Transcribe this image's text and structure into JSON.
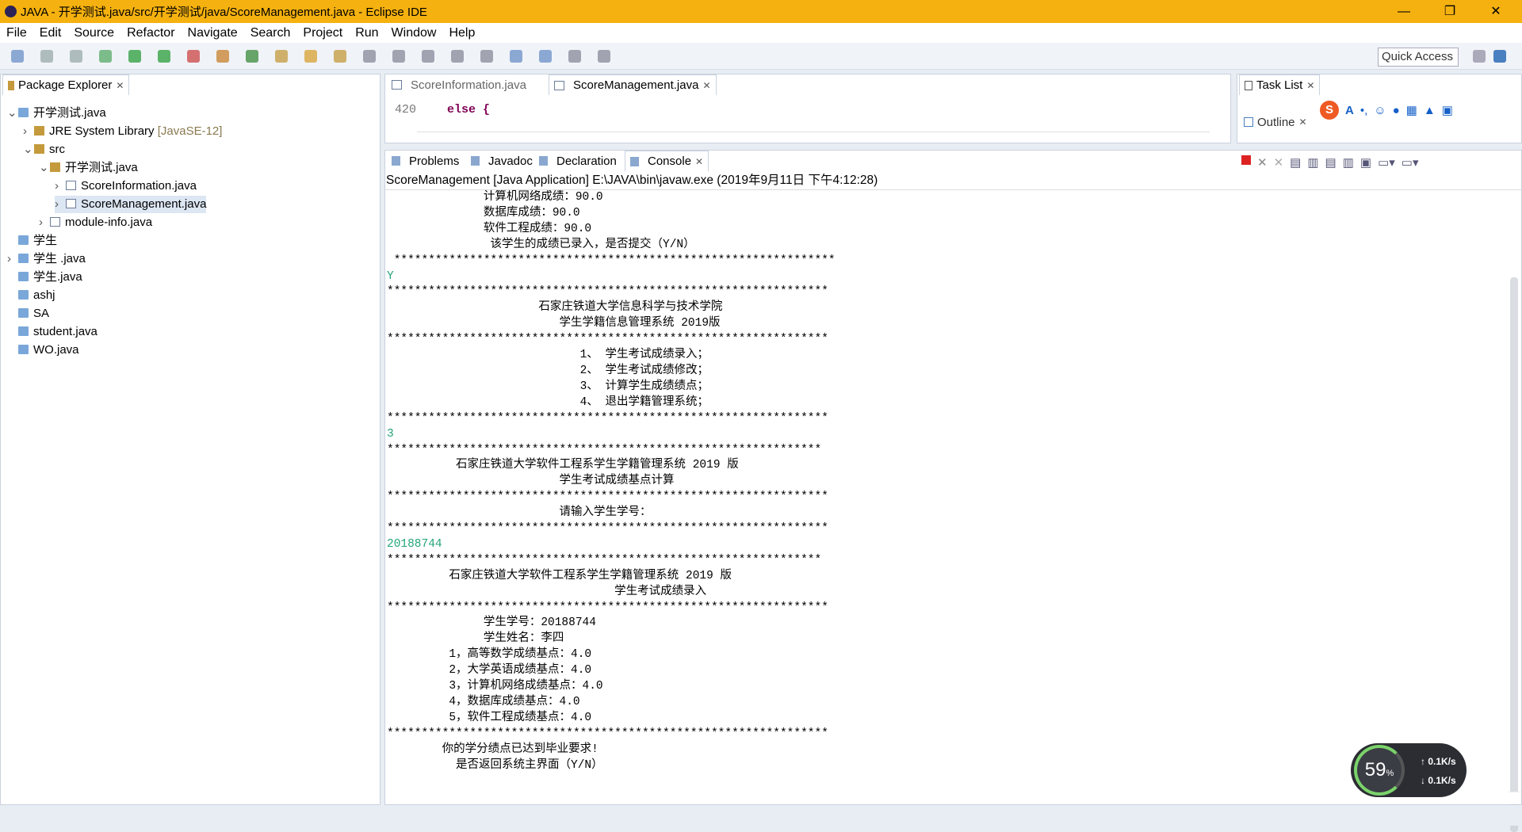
{
  "window": {
    "title": "JAVA - 开学测试.java/src/开学测试/java/ScoreManagement.java - Eclipse IDE",
    "minimize": "—",
    "maximize": "❐",
    "close": "✕"
  },
  "menu": [
    "File",
    "Edit",
    "Source",
    "Refactor",
    "Navigate",
    "Search",
    "Project",
    "Run",
    "Window",
    "Help"
  ],
  "toolbar": {
    "quick_access": "Quick Access"
  },
  "package_explorer": {
    "title": "Package Explorer",
    "items": [
      {
        "label": "开学测试.java",
        "depth": 0,
        "icon": "project-icon",
        "expand": "⌄"
      },
      {
        "label": "JRE System Library",
        "suffix": "[JavaSE-12]",
        "depth": 1,
        "icon": "library-icon",
        "expand": "›"
      },
      {
        "label": "src",
        "depth": 1,
        "icon": "source-folder-icon",
        "expand": "⌄"
      },
      {
        "label": "开学测试.java",
        "depth": 2,
        "icon": "package-icon",
        "expand": "⌄"
      },
      {
        "label": "ScoreInformation.java",
        "depth": 3,
        "icon": "java-file-icon",
        "expand": "›"
      },
      {
        "label": "ScoreManagement.java",
        "depth": 3,
        "icon": "java-file-icon",
        "expand": "›",
        "selected": true
      },
      {
        "label": "module-info.java",
        "depth": 2,
        "icon": "java-file-icon",
        "expand": "›"
      },
      {
        "label": "学生",
        "depth": 0,
        "icon": "folder-icon",
        "expand": ""
      },
      {
        "label": "学生 .java",
        "depth": 0,
        "icon": "project-icon",
        "expand": "›"
      },
      {
        "label": "学生.java",
        "depth": 0,
        "icon": "folder-icon",
        "expand": ""
      },
      {
        "label": "ashj",
        "depth": 0,
        "icon": "folder-icon",
        "expand": ""
      },
      {
        "label": "SA",
        "depth": 0,
        "icon": "folder-icon",
        "expand": ""
      },
      {
        "label": "student.java",
        "depth": 0,
        "icon": "folder-icon",
        "expand": ""
      },
      {
        "label": "WO.java",
        "depth": 0,
        "icon": "folder-icon",
        "expand": ""
      }
    ]
  },
  "editor": {
    "tabs": [
      {
        "label": "ScoreInformation.java",
        "active": false
      },
      {
        "label": "ScoreManagement.java",
        "active": true
      }
    ],
    "lines": [
      {
        "num": "420",
        "code": "else {"
      }
    ]
  },
  "right_panel": {
    "task_list": "Task List",
    "outline": "Outline"
  },
  "bottom_tabs": [
    {
      "label": "Problems",
      "icon": "problems-icon"
    },
    {
      "label": "Javadoc",
      "icon": "javadoc-icon"
    },
    {
      "label": "Declaration",
      "icon": "declaration-icon"
    },
    {
      "label": "Console",
      "icon": "console-icon",
      "active": true
    }
  ],
  "console": {
    "header": "ScoreManagement [Java Application] E:\\JAVA\\bin\\javaw.exe (2019年9月11日 下午4:12:28)",
    "lines": [
      {
        "t": "              计算机网络成绩：90.0"
      },
      {
        "t": "              数据库成绩：90.0"
      },
      {
        "t": "              软件工程成绩：90.0"
      },
      {
        "t": "               该学生的成绩已录入，是否提交（Y/N）"
      },
      {
        "t": " ****************************************************************"
      },
      {
        "t": "Y",
        "input": true
      },
      {
        "t": "****************************************************************"
      },
      {
        "t": "                      石家庄铁道大学信息科学与技术学院"
      },
      {
        "t": "                         学生学籍信息管理系统 2019版"
      },
      {
        "t": "****************************************************************"
      },
      {
        "t": "                            1、 学生考试成绩录入；"
      },
      {
        "t": "                            2、 学生考试成绩修改；"
      },
      {
        "t": "                            3、 计算学生成绩绩点；"
      },
      {
        "t": "                            4、 退出学籍管理系统；"
      },
      {
        "t": "****************************************************************"
      },
      {
        "t": "3",
        "input": true
      },
      {
        "t": "***************************************************************"
      },
      {
        "t": "          石家庄铁道大学软件工程系学生学籍管理系统 2019 版"
      },
      {
        "t": "                         学生考试成绩基点计算"
      },
      {
        "t": "****************************************************************"
      },
      {
        "t": "                         请输入学生学号："
      },
      {
        "t": "****************************************************************"
      },
      {
        "t": "20188744",
        "input": true
      },
      {
        "t": "***************************************************************"
      },
      {
        "t": "         石家庄铁道大学软件工程系学生学籍管理系统 2019 版"
      },
      {
        "t": "                                 学生考试成绩录入"
      },
      {
        "t": "****************************************************************"
      },
      {
        "t": "              学生学号：20188744"
      },
      {
        "t": "              学生姓名：李四"
      },
      {
        "t": "         1，高等数学成绩基点：4.0"
      },
      {
        "t": "         2，大学英语成绩基点：4.0"
      },
      {
        "t": "         3，计算机网络成绩基点：4.0"
      },
      {
        "t": "         4，数据库成绩基点：4.0"
      },
      {
        "t": "         5，软件工程成绩基点：4.0"
      },
      {
        "t": "****************************************************************"
      },
      {
        "t": "        你的学分绩点已达到毕业要求!"
      },
      {
        "t": "          是否返回系统主界面（Y/N）"
      }
    ]
  },
  "net_monitor": {
    "percent": "59",
    "unit": "%",
    "up": "↑ 0.1K/s",
    "down": "↓ 0.1K/s"
  },
  "colors": {
    "titlebar": "#f5b10f",
    "input_text": "#23a47a",
    "selection": "#dde6f3"
  }
}
